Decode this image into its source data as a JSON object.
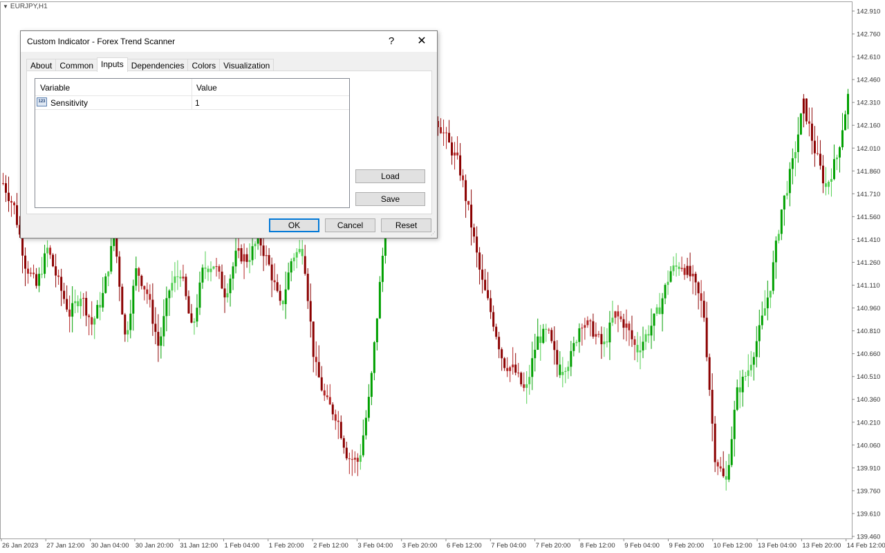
{
  "chart": {
    "symbol_label": "EURJPY,H1",
    "colors": {
      "bull": "#00a000",
      "bull_light": "#4fcf4f",
      "bear": "#8b0000",
      "bear_light": "#b22222",
      "grid": "#c8c8c8",
      "axis_text": "#333333"
    },
    "price_axis": [
      "142.910",
      "142.760",
      "142.610",
      "142.460",
      "142.310",
      "142.160",
      "142.010",
      "141.860",
      "141.710",
      "141.560",
      "141.410",
      "141.260",
      "141.110",
      "140.960",
      "140.810",
      "140.660",
      "140.510",
      "140.360",
      "140.210",
      "140.060",
      "139.910",
      "139.760",
      "139.610",
      "139.460"
    ],
    "time_axis": [
      "26 Jan 2023",
      "27 Jan 12:00",
      "30 Jan 04:00",
      "30 Jan 20:00",
      "31 Jan 12:00",
      "1 Feb 04:00",
      "1 Feb 20:00",
      "2 Feb 12:00",
      "3 Feb 04:00",
      "3 Feb 20:00",
      "6 Feb 12:00",
      "7 Feb 04:00",
      "7 Feb 20:00",
      "8 Feb 12:00",
      "9 Feb 04:00",
      "9 Feb 20:00",
      "10 Feb 12:00",
      "13 Feb 04:00",
      "13 Feb 20:00",
      "14 Feb 12:00"
    ],
    "close_path": [
      141.78,
      141.62,
      141.25,
      141.1,
      141.35,
      141.12,
      140.92,
      141.05,
      140.85,
      141.05,
      141.45,
      140.75,
      141.22,
      141.05,
      140.7,
      141.1,
      141.2,
      140.8,
      141.22,
      141.25,
      141.05,
      141.32,
      141.28,
      141.42,
      141.22,
      140.95,
      141.3,
      141.35,
      140.6,
      140.35,
      140.25,
      139.98,
      139.95,
      140.4,
      141.2,
      141.95,
      142.6,
      142.35,
      142.3,
      142.2,
      142.05,
      141.9,
      141.55,
      141.15,
      140.9,
      140.6,
      140.55,
      140.4,
      140.75,
      140.8,
      140.55,
      140.62,
      140.88,
      140.82,
      140.7,
      140.92,
      140.85,
      140.68,
      140.8,
      140.95,
      141.2,
      141.25,
      141.15,
      140.95,
      140.0,
      139.8,
      140.4,
      140.55,
      140.8,
      141.1,
      141.6,
      141.9,
      142.3,
      142.0,
      141.75,
      141.95,
      142.35
    ]
  },
  "dialog": {
    "title": "Custom Indicator - Forex Trend Scanner",
    "help_glyph": "?",
    "close_glyph": "✕",
    "tabs": [
      "About",
      "Common",
      "Inputs",
      "Dependencies",
      "Colors",
      "Visualization"
    ],
    "active_tab": "Inputs",
    "grid": {
      "headers": {
        "variable": "Variable",
        "value": "Value"
      },
      "rows": [
        {
          "icon": "123",
          "variable": "Sensitivity",
          "value": "1"
        }
      ]
    },
    "side_buttons": {
      "load": "Load",
      "save": "Save"
    },
    "buttons": {
      "ok": "OK",
      "cancel": "Cancel",
      "reset": "Reset"
    }
  }
}
